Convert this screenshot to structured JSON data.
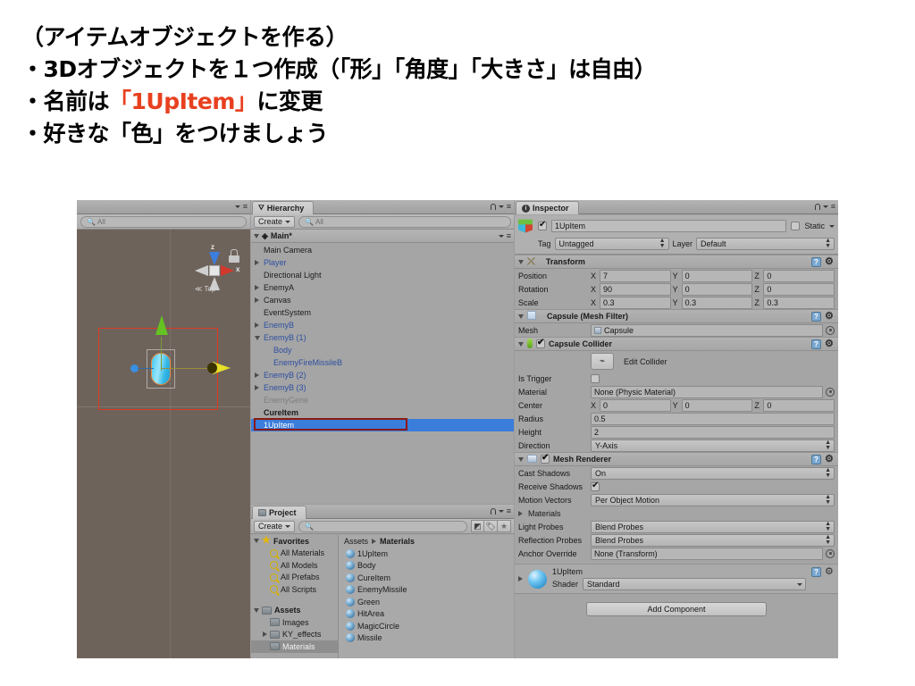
{
  "slide": {
    "lines": [
      {
        "text": "（アイテムオブジェクトを作る）",
        "highlight": null
      },
      {
        "text": "・3Dオブジェクトを１つ作成（「形」「角度」「大きさ」は自由）",
        "highlight": null
      },
      {
        "pre": "・名前は",
        "highlight": "「1UpItem」",
        "post": "に変更"
      },
      {
        "text": "・好きな「色」をつけましょう",
        "highlight": null
      }
    ],
    "highlight_color": "#e8401f"
  },
  "unity": {
    "scene_view": {
      "search_placeholder": "All",
      "gizmo": {
        "axis_x": "x",
        "axis_z": "z",
        "view_label": "Top"
      }
    },
    "hierarchy": {
      "tab_label": "Hierarchy",
      "create_button": "Create",
      "search_placeholder": "All",
      "scene_name": "Main*",
      "items": [
        {
          "label": "Main Camera",
          "indent": 1,
          "arrow": "none",
          "style": "normal"
        },
        {
          "label": "Player",
          "indent": 1,
          "arrow": "right",
          "style": "prefab"
        },
        {
          "label": "Directional Light",
          "indent": 1,
          "arrow": "none",
          "style": "normal"
        },
        {
          "label": "EnemyA",
          "indent": 1,
          "arrow": "right",
          "style": "normal"
        },
        {
          "label": "Canvas",
          "indent": 1,
          "arrow": "right",
          "style": "normal"
        },
        {
          "label": "EventSystem",
          "indent": 1,
          "arrow": "none",
          "style": "normal"
        },
        {
          "label": "EnemyB",
          "indent": 1,
          "arrow": "right",
          "style": "prefab"
        },
        {
          "label": "EnemyB (1)",
          "indent": 1,
          "arrow": "down",
          "style": "prefab"
        },
        {
          "label": "Body",
          "indent": 2,
          "arrow": "none",
          "style": "prefab"
        },
        {
          "label": "EnemyFireMissileB",
          "indent": 2,
          "arrow": "none",
          "style": "prefab"
        },
        {
          "label": "EnemyB (2)",
          "indent": 1,
          "arrow": "right",
          "style": "prefab"
        },
        {
          "label": "EnemyB (3)",
          "indent": 1,
          "arrow": "right",
          "style": "prefab"
        },
        {
          "label": "EnemyGene",
          "indent": 1,
          "arrow": "none",
          "style": "dim"
        },
        {
          "label": "CureItem",
          "indent": 1,
          "arrow": "none",
          "style": "bold"
        },
        {
          "label": "1UpItem",
          "indent": 1,
          "arrow": "none",
          "style": "selected"
        }
      ]
    },
    "project": {
      "tab_label": "Project",
      "create_button": "Create",
      "search_placeholder": "",
      "tree": [
        {
          "label": "Favorites",
          "kind": "favorites-head",
          "indent": 0,
          "arrow": "down"
        },
        {
          "label": "All Materials",
          "kind": "saved-search",
          "indent": 1,
          "arrow": "none"
        },
        {
          "label": "All Models",
          "kind": "saved-search",
          "indent": 1,
          "arrow": "none"
        },
        {
          "label": "All Prefabs",
          "kind": "saved-search",
          "indent": 1,
          "arrow": "none"
        },
        {
          "label": "All Scripts",
          "kind": "saved-search",
          "indent": 1,
          "arrow": "none"
        },
        {
          "label": "",
          "kind": "spacer",
          "indent": 0,
          "arrow": "none"
        },
        {
          "label": "Assets",
          "kind": "folder-head",
          "indent": 0,
          "arrow": "down"
        },
        {
          "label": "Images",
          "kind": "folder",
          "indent": 1,
          "arrow": "none"
        },
        {
          "label": "KY_effects",
          "kind": "folder",
          "indent": 1,
          "arrow": "right"
        },
        {
          "label": "Materials",
          "kind": "folder",
          "indent": 1,
          "arrow": "none",
          "selected": true
        }
      ],
      "breadcrumb": [
        "Assets",
        "Materials"
      ],
      "assets": [
        "1UpItem",
        "Body",
        "CureItem",
        "EnemyMissile",
        "Green",
        "HitArea",
        "MagicCircle",
        "Missile"
      ],
      "toolbar_icons": [
        "prefab-filter-icon",
        "label-filter-icon",
        "favorite-filter-icon"
      ]
    },
    "inspector": {
      "tab_label": "Inspector",
      "object_name": "1UpItem",
      "object_enabled": true,
      "static_label": "Static",
      "static_checked": false,
      "tag_label": "Tag",
      "tag_value": "Untagged",
      "layer_label": "Layer",
      "layer_value": "Default",
      "components": [
        {
          "name": "Transform",
          "icon": "transform-icon",
          "has_checkbox": false,
          "rows": [
            {
              "type": "vector3",
              "label": "Position",
              "x": "7",
              "y": "0",
              "z": "0"
            },
            {
              "type": "vector3",
              "label": "Rotation",
              "x": "90",
              "y": "0",
              "z": "0"
            },
            {
              "type": "vector3",
              "label": "Scale",
              "x": "0.3",
              "y": "0.3",
              "z": "0.3"
            }
          ]
        },
        {
          "name": "Capsule (Mesh Filter)",
          "icon": "mesh-filter-icon",
          "has_checkbox": false,
          "rows": [
            {
              "type": "object",
              "label": "Mesh",
              "value": "Capsule"
            }
          ]
        },
        {
          "name": "Capsule Collider",
          "icon": "capsule-collider-icon",
          "has_checkbox": true,
          "checked": true,
          "rows": [
            {
              "type": "edit-collider",
              "button_label": "Edit Collider"
            },
            {
              "type": "checkbox",
              "label": "Is Trigger",
              "checked": false
            },
            {
              "type": "object",
              "label": "Material",
              "value": "None (Physic Material)"
            },
            {
              "type": "vector3",
              "label": "Center",
              "x": "0",
              "y": "0",
              "z": "0"
            },
            {
              "type": "text",
              "label": "Radius",
              "value": "0.5"
            },
            {
              "type": "text",
              "label": "Height",
              "value": "2"
            },
            {
              "type": "dropdown",
              "label": "Direction",
              "value": "Y-Axis"
            }
          ]
        },
        {
          "name": "Mesh Renderer",
          "icon": "mesh-renderer-icon",
          "has_checkbox": true,
          "checked": true,
          "rows": [
            {
              "type": "dropdown",
              "label": "Cast Shadows",
              "value": "On"
            },
            {
              "type": "checkbox",
              "label": "Receive Shadows",
              "checked": true
            },
            {
              "type": "dropdown",
              "label": "Motion Vectors",
              "value": "Per Object Motion"
            },
            {
              "type": "foldout",
              "label": "Materials"
            },
            {
              "type": "dropdown",
              "label": "Light Probes",
              "value": "Blend Probes"
            },
            {
              "type": "dropdown",
              "label": "Reflection Probes",
              "value": "Blend Probes"
            },
            {
              "type": "object",
              "label": "Anchor Override",
              "value": "None (Transform)"
            }
          ]
        }
      ],
      "material": {
        "name": "1UpItem",
        "shader_label": "Shader",
        "shader_value": "Standard"
      },
      "add_component_label": "Add Component"
    }
  }
}
